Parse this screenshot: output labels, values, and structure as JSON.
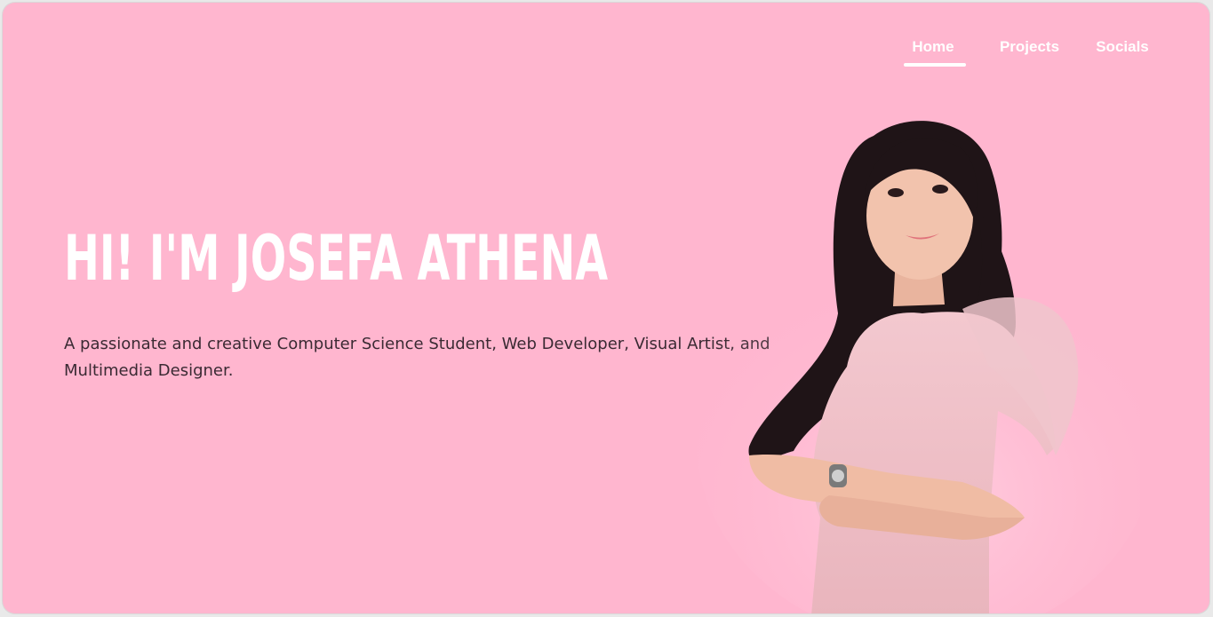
{
  "nav": {
    "items": [
      {
        "label": "Home",
        "active": true
      },
      {
        "label": "Projects",
        "active": false
      },
      {
        "label": "Socials",
        "active": false
      }
    ]
  },
  "hero": {
    "title": "HI! I'M JOSEFA ATHENA",
    "tagline": "A passionate and creative Computer Science Student, Web Developer, Visual Artist, and Multimedia Designer."
  },
  "colors": {
    "background": "#ffb6cf",
    "title": "#ffffff",
    "tagline": "#3a2a33",
    "nav_text": "#ffffff"
  }
}
